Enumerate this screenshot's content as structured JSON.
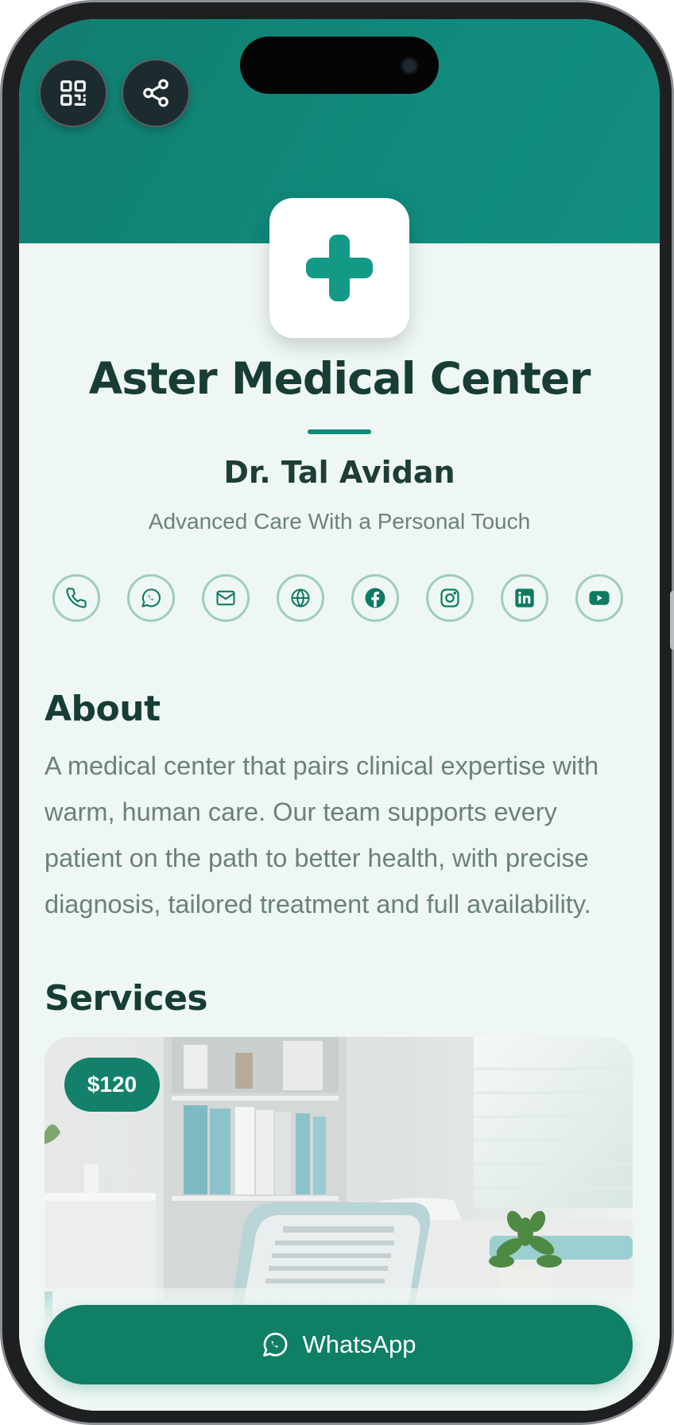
{
  "header": {
    "qr_icon": "qr-code-icon",
    "share_icon": "share-icon"
  },
  "business": {
    "logo_icon": "medical-cross-icon",
    "name": "Aster Medical Center",
    "owner": "Dr. Tal Avidan",
    "tagline": "Advanced Care With a Personal Touch"
  },
  "socials": [
    {
      "icon": "phone-icon"
    },
    {
      "icon": "whatsapp-icon"
    },
    {
      "icon": "mail-icon"
    },
    {
      "icon": "globe-icon"
    },
    {
      "icon": "facebook-icon"
    },
    {
      "icon": "instagram-icon"
    },
    {
      "icon": "linkedin-icon"
    },
    {
      "icon": "youtube-icon"
    }
  ],
  "about": {
    "title": "About",
    "text": "A medical center that pairs clinical expertise with warm, human care. Our team supports every patient on the path to better health, with precise diagnosis, tailored treatment and full availability."
  },
  "services": {
    "title": "Services",
    "items": [
      {
        "price": "$120"
      }
    ]
  },
  "cta": {
    "label": "WhatsApp",
    "icon": "whatsapp-icon"
  },
  "colors": {
    "brand": "#0f8a78",
    "cta": "#0f7f66",
    "background": "#eef7f4",
    "heading": "#173d35"
  }
}
